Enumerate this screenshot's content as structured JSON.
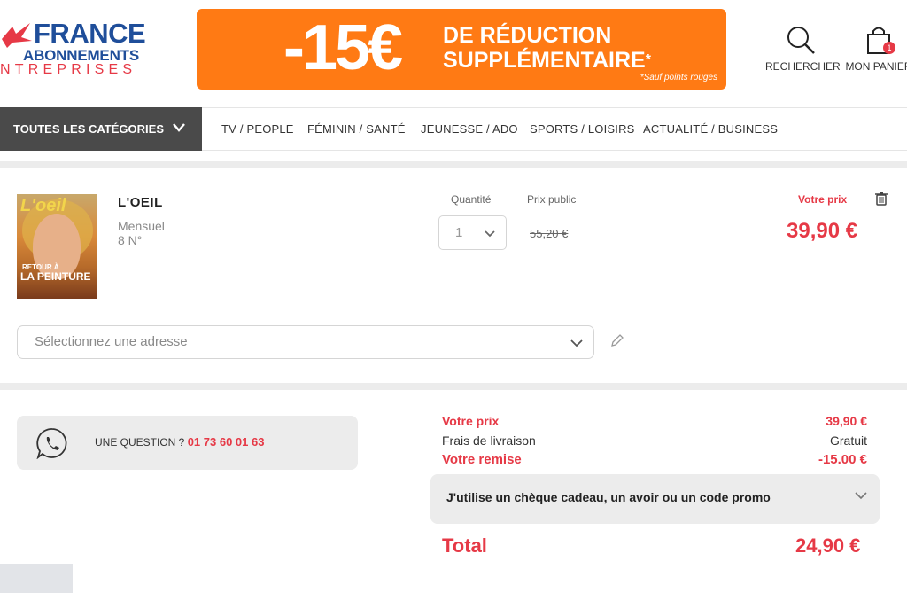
{
  "header": {
    "logo": {
      "line1": "FRANCE",
      "line2": "ABONNEMENTS",
      "line3": "NTREPRISES"
    },
    "banner": {
      "amount": "-15€",
      "line1": "DE RÉDUCTION",
      "line2": "SUPPLÉMENTAIRE",
      "star": "*",
      "note": "*Sauf points rouges"
    },
    "search_label": "RECHERCHER",
    "cart_label": "MON PANIER",
    "cart_count": "1"
  },
  "nav": {
    "all_categories": "TOUTES LES CATÉGORIES",
    "items": [
      "TV / PEOPLE",
      "FÉMININ / SANTÉ",
      "JEUNESSE / ADO",
      "SPORTS / LOISIRS",
      "ACTUALITÉ / BUSINESS"
    ]
  },
  "product": {
    "cover": {
      "masthead": "L'oeil",
      "caption1": "RETOUR À",
      "caption2": "LA PEINTURE"
    },
    "name": "L'OEIL",
    "frequency": "Mensuel",
    "issues": "8 N°",
    "quantity_label": "Quantité",
    "quantity_value": "1",
    "public_price_label": "Prix public",
    "public_price": "55,20 €",
    "your_price_label": "Votre prix",
    "your_price": "39,90 €"
  },
  "address": {
    "placeholder": "Sélectionnez une adresse"
  },
  "contact": {
    "label": "UNE QUESTION ?",
    "phone": "01 73 60 01 63"
  },
  "summary": {
    "your_price_label": "Votre prix",
    "your_price": "39,90 €",
    "shipping_label": "Frais de livraison",
    "shipping_value": "Gratuit",
    "discount_label": "Votre remise",
    "discount_value": "-15.00 €",
    "promo_label": "J'utilise un chèque cadeau, un avoir ou un code promo",
    "total_label": "Total",
    "total_value": "24,90 €"
  },
  "colors": {
    "accent": "#e63946",
    "banner": "#ff7a14",
    "brand_blue": "#1f4e9a",
    "nav_dark": "#4a4a4a"
  }
}
